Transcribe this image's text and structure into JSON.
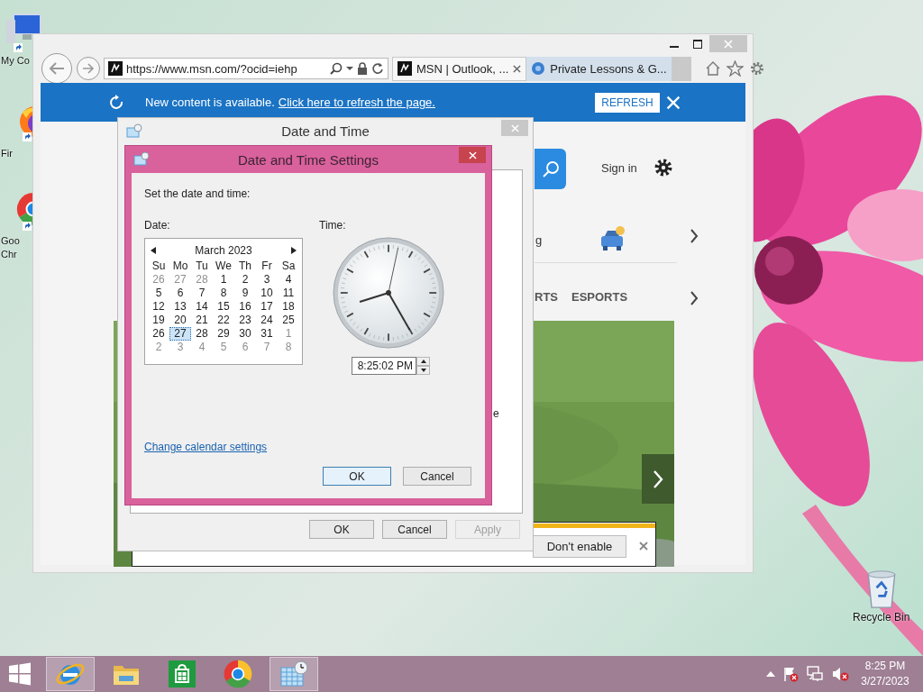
{
  "desktop": {
    "icons": [
      {
        "kind": "computer",
        "label": "My Co"
      },
      {
        "kind": "firefox",
        "label": "Fir"
      },
      {
        "kind": "chrome",
        "label": "Goo Chr"
      },
      {
        "kind": "recycle",
        "label": "Recycle Bin"
      }
    ]
  },
  "browser": {
    "address": "https://www.msn.com/?ocid=iehp",
    "tabs": [
      {
        "label": "MSN | Outlook, ...",
        "selected": true
      },
      {
        "label": "Private Lessons & G...",
        "selected": false
      }
    ],
    "notification": {
      "text": "New content is available.",
      "link": "Click here to refresh the page.",
      "button": "REFRESH"
    },
    "page": {
      "sign_in": "Sign in",
      "fragment": "g",
      "nav": [
        "RTS",
        "ESPORTS"
      ],
      "popup_button": "Don't enable"
    }
  },
  "date_time_window": {
    "title": "Date and Time",
    "fragment": "e",
    "buttons": [
      {
        "label": "OK",
        "disabled": false
      },
      {
        "label": "Cancel",
        "disabled": false
      },
      {
        "label": "Apply",
        "disabled": true
      }
    ]
  },
  "settings_dialog": {
    "title": "Date and Time Settings",
    "prompt": "Set the date and time:",
    "date_label": "Date:",
    "time_label": "Time:",
    "calendar": {
      "month": "March 2023",
      "weekdays": [
        "Su",
        "Mo",
        "Tu",
        "We",
        "Th",
        "Fr",
        "Sa"
      ],
      "weeks": [
        [
          {
            "day": "26",
            "muted": true,
            "selected": false
          },
          {
            "day": "27",
            "muted": true,
            "selected": false
          },
          {
            "day": "28",
            "muted": true,
            "selected": false
          },
          {
            "day": "1",
            "muted": false,
            "selected": false
          },
          {
            "day": "2",
            "muted": false,
            "selected": false
          },
          {
            "day": "3",
            "muted": false,
            "selected": false
          },
          {
            "day": "4",
            "muted": false,
            "selected": false
          }
        ],
        [
          {
            "day": "5",
            "muted": false,
            "selected": false
          },
          {
            "day": "6",
            "muted": false,
            "selected": false
          },
          {
            "day": "7",
            "muted": false,
            "selected": false
          },
          {
            "day": "8",
            "muted": false,
            "selected": false
          },
          {
            "day": "9",
            "muted": false,
            "selected": false
          },
          {
            "day": "10",
            "muted": false,
            "selected": false
          },
          {
            "day": "11",
            "muted": false,
            "selected": false
          }
        ],
        [
          {
            "day": "12",
            "muted": false,
            "selected": false
          },
          {
            "day": "13",
            "muted": false,
            "selected": false
          },
          {
            "day": "14",
            "muted": false,
            "selected": false
          },
          {
            "day": "15",
            "muted": false,
            "selected": false
          },
          {
            "day": "16",
            "muted": false,
            "selected": false
          },
          {
            "day": "17",
            "muted": false,
            "selected": false
          },
          {
            "day": "18",
            "muted": false,
            "selected": false
          }
        ],
        [
          {
            "day": "19",
            "muted": false,
            "selected": false
          },
          {
            "day": "20",
            "muted": false,
            "selected": false
          },
          {
            "day": "21",
            "muted": false,
            "selected": false
          },
          {
            "day": "22",
            "muted": false,
            "selected": false
          },
          {
            "day": "23",
            "muted": false,
            "selected": false
          },
          {
            "day": "24",
            "muted": false,
            "selected": false
          },
          {
            "day": "25",
            "muted": false,
            "selected": false
          }
        ],
        [
          {
            "day": "26",
            "muted": false,
            "selected": false
          },
          {
            "day": "27",
            "muted": false,
            "selected": true
          },
          {
            "day": "28",
            "muted": false,
            "selected": false
          },
          {
            "day": "29",
            "muted": false,
            "selected": false
          },
          {
            "day": "30",
            "muted": false,
            "selected": false
          },
          {
            "day": "31",
            "muted": false,
            "selected": false
          },
          {
            "day": "1",
            "muted": true,
            "selected": false
          }
        ],
        [
          {
            "day": "2",
            "muted": true,
            "selected": false
          },
          {
            "day": "3",
            "muted": true,
            "selected": false
          },
          {
            "day": "4",
            "muted": true,
            "selected": false
          },
          {
            "day": "5",
            "muted": true,
            "selected": false
          },
          {
            "day": "6",
            "muted": true,
            "selected": false
          },
          {
            "day": "7",
            "muted": true,
            "selected": false
          },
          {
            "day": "8",
            "muted": true,
            "selected": false
          }
        ]
      ]
    },
    "time": "8:25:02 PM",
    "link": "Change calendar settings",
    "buttons": [
      {
        "label": "OK",
        "default": true
      },
      {
        "label": "Cancel",
        "default": false
      }
    ]
  },
  "taskbar": {
    "apps": [
      {
        "kind": "ie",
        "active": true
      },
      {
        "kind": "explorer",
        "active": false
      },
      {
        "kind": "store",
        "active": false
      },
      {
        "kind": "chrome",
        "active": false
      },
      {
        "kind": "datetime",
        "active": true
      }
    ],
    "clock": {
      "time": "8:25 PM",
      "date": "3/27/2023"
    }
  }
}
